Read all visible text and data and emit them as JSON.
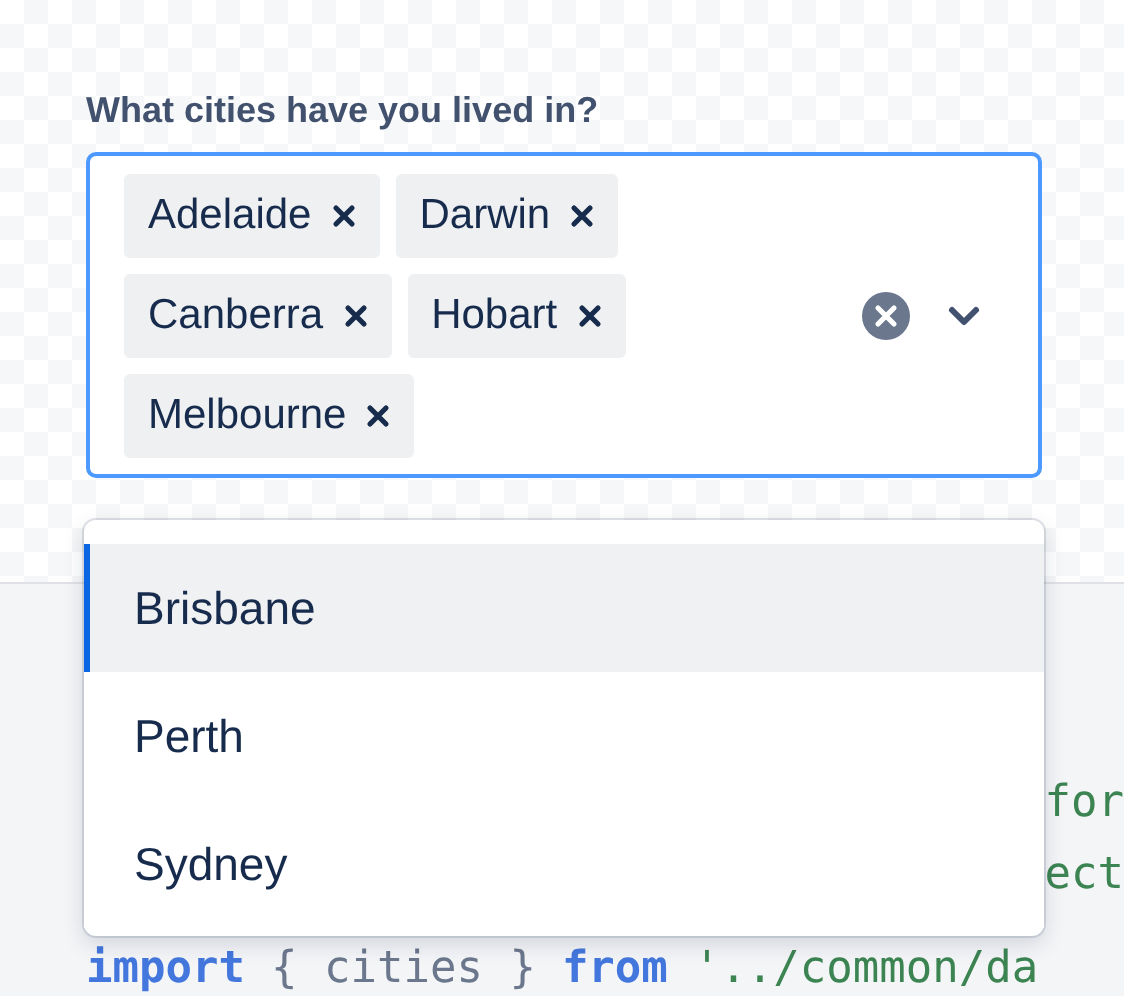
{
  "field": {
    "label": "What cities have you lived in?",
    "tags": [
      {
        "label": "Adelaide"
      },
      {
        "label": "Darwin"
      },
      {
        "label": "Canberra"
      },
      {
        "label": "Hobart"
      },
      {
        "label": "Melbourne"
      }
    ],
    "focused": true
  },
  "menu": {
    "options": [
      {
        "label": "Brisbane",
        "selected": true
      },
      {
        "label": "Perth",
        "selected": false
      },
      {
        "label": "Sydney",
        "selected": false
      }
    ]
  },
  "code": [
    {
      "kind": "fragment",
      "segments": [
        {
          "kind": "string",
          "text": "for"
        }
      ]
    },
    {
      "kind": "fragment",
      "segments": [
        {
          "kind": "string",
          "text": "ect"
        }
      ]
    },
    {
      "kind": "line",
      "segments": [
        {
          "kind": "keyword",
          "text": "import"
        },
        {
          "kind": "plain",
          "text": "{ cities }"
        },
        {
          "kind": "keyword",
          "text": "from"
        },
        {
          "kind": "string",
          "text": "'../common/da"
        }
      ]
    }
  ]
}
